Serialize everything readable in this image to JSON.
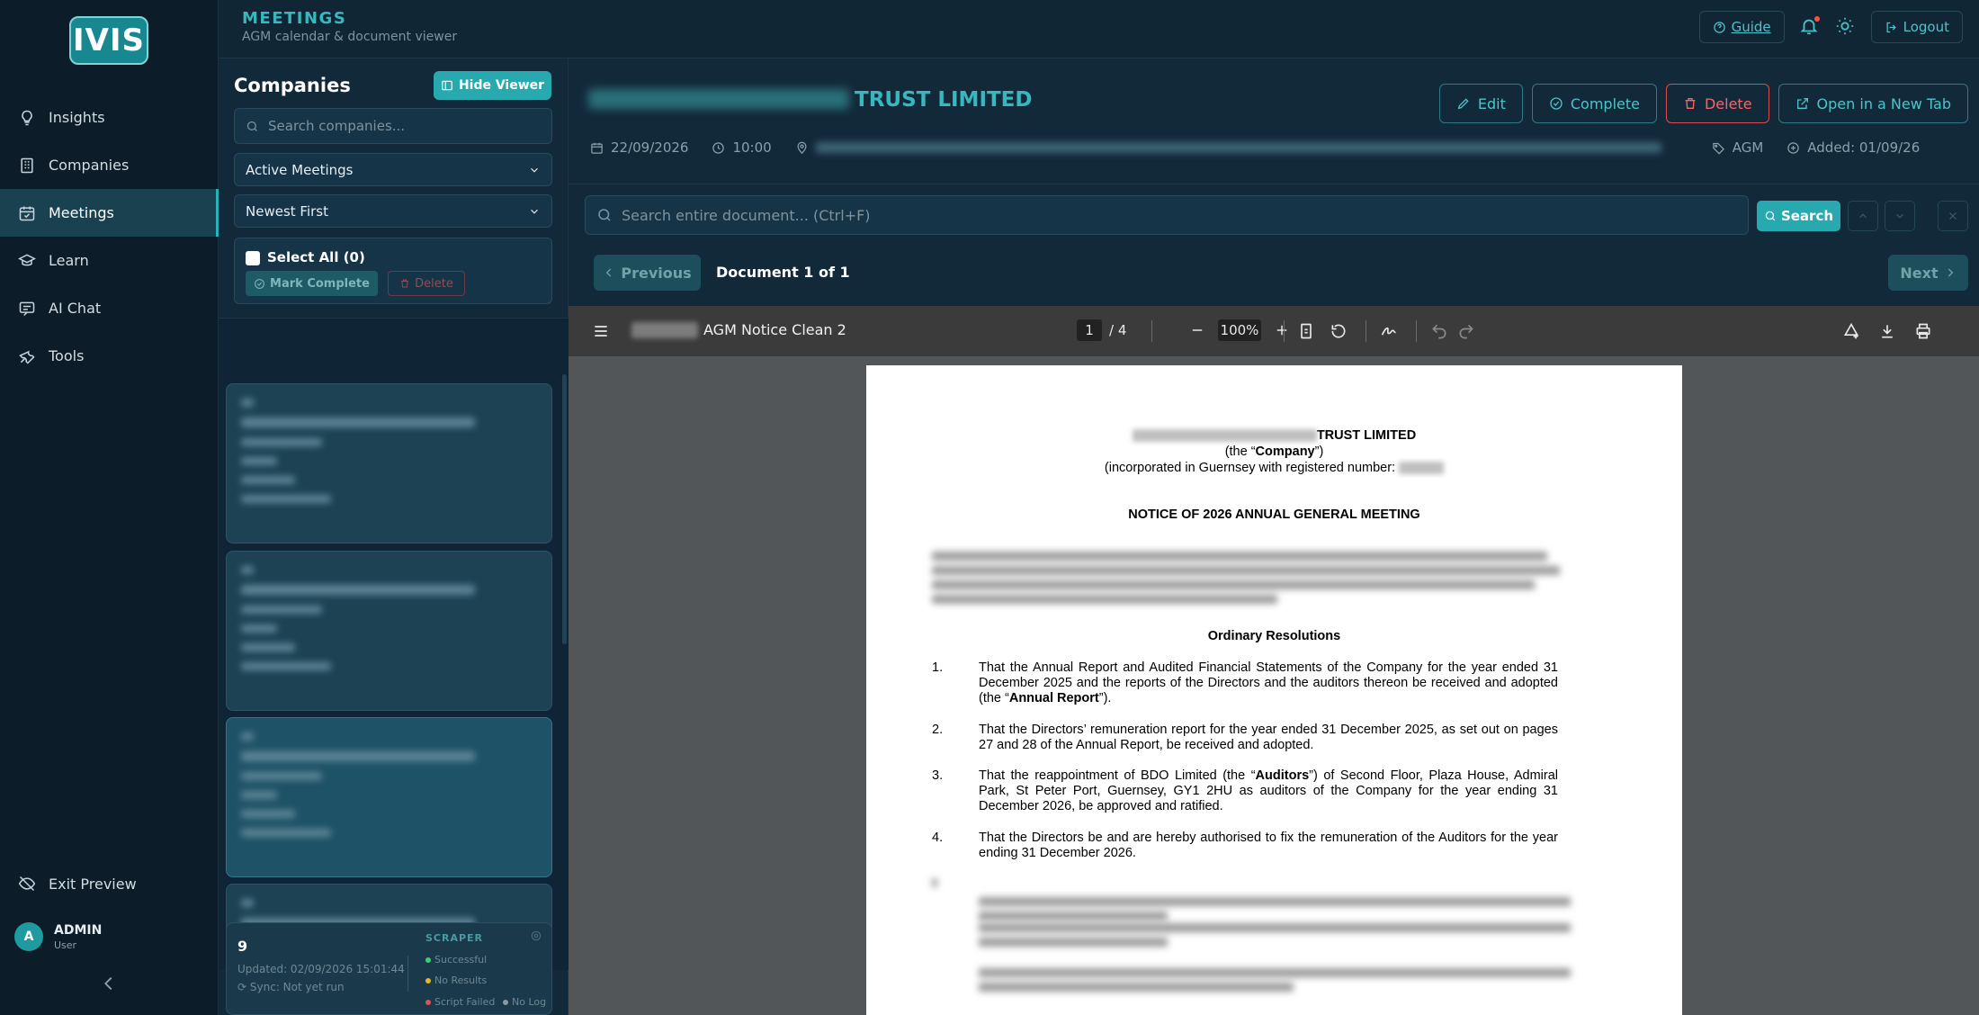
{
  "app": {
    "logo": "IVIS"
  },
  "sidebar": {
    "items": [
      {
        "label": "Insights",
        "icon": "lightbulb-icon"
      },
      {
        "label": "Companies",
        "icon": "building-icon"
      },
      {
        "label": "Meetings",
        "icon": "calendar-check-icon"
      },
      {
        "label": "Learn",
        "icon": "graduation-cap-icon"
      },
      {
        "label": "AI Chat",
        "icon": "chat-icon"
      },
      {
        "label": "Tools",
        "icon": "tools-icon"
      }
    ],
    "active": "Meetings",
    "exit_preview": "Exit Preview",
    "user": {
      "initial": "A",
      "name": "ADMIN",
      "role": "User"
    }
  },
  "header": {
    "title": "MEETINGS",
    "subtitle": "AGM calendar & document viewer",
    "guide": "Guide",
    "logout": "Logout"
  },
  "companies": {
    "title": "Companies",
    "hide_viewer": "Hide Viewer",
    "search_placeholder": "Search companies...",
    "filter": "Active Meetings",
    "sort": "Newest First",
    "select_all": "Select All (0)",
    "mark_complete": "Mark Complete",
    "delete": "Delete"
  },
  "scraper": {
    "count": "9",
    "updated": "Updated: 02/09/2026 15:01:44",
    "sync": "Sync: Not yet run",
    "label": "SCRAPER",
    "legend": [
      {
        "label": "Successful",
        "color": "#3fcf6b"
      },
      {
        "label": "No Results",
        "color": "#e8b62a"
      },
      {
        "label": "Script Failed",
        "color": "#e05353"
      },
      {
        "label": "No Log",
        "color": "#8a9aa3"
      }
    ]
  },
  "meeting": {
    "title_suffix": "TRUST LIMITED",
    "date": "22/09/2026",
    "time": "10:00",
    "type": "AGM",
    "added": "Added: 01/09/26",
    "actions": {
      "edit": "Edit",
      "complete": "Complete",
      "delete": "Delete",
      "open_tab": "Open in a New Tab"
    }
  },
  "doc_search": {
    "placeholder": "Search entire document... (Ctrl+F)",
    "button": "Search"
  },
  "doc_nav": {
    "previous": "Previous",
    "count": "Document 1 of 1",
    "next": "Next"
  },
  "pdf": {
    "filename": "AGM Notice Clean 2",
    "page": "1",
    "page_total": "/ 4",
    "zoom": "100%",
    "company_suffix": "TRUST LIMITED",
    "the_company_pre": "(the “",
    "the_company_bold": "Company",
    "the_company_post": "”)",
    "incorporated": "(incorporated in Guernsey with registered number:",
    "notice": "NOTICE OF 2026 ANNUAL GENERAL MEETING",
    "ordinary": "Ordinary Resolutions",
    "resolutions": [
      {
        "n": "1.",
        "pre": "That the Annual Report and Audited Financial Statements of the Company for the year ended 31 December 2025 and the reports of the Directors and the auditors thereon be received and adopted (the “",
        "bold": "Annual Report",
        "post": "”)."
      },
      {
        "n": "2.",
        "pre": "That the Directors’ remuneration report for the year ended 31 December 2025, as set out on pages 27 and 28 of the Annual Report, be received and adopted.",
        "bold": "",
        "post": ""
      },
      {
        "n": "3.",
        "pre": "That the reappointment of BDO Limited (the “",
        "bold": "Auditors",
        "post": "”) of Second Floor, Plaza House, Admiral Park, St Peter Port, Guernsey, GY1 2HU as auditors of the Company for the year ending 31 December 2026, be approved and ratified."
      },
      {
        "n": "4.",
        "pre": "That the Directors be and are hereby authorised to fix the remuneration of the Auditors for the year ending 31 December 2026.",
        "bold": "",
        "post": ""
      }
    ]
  },
  "colors": {
    "accent": "#28a9af",
    "danger": "#ff6363",
    "background": "#0f2230"
  }
}
